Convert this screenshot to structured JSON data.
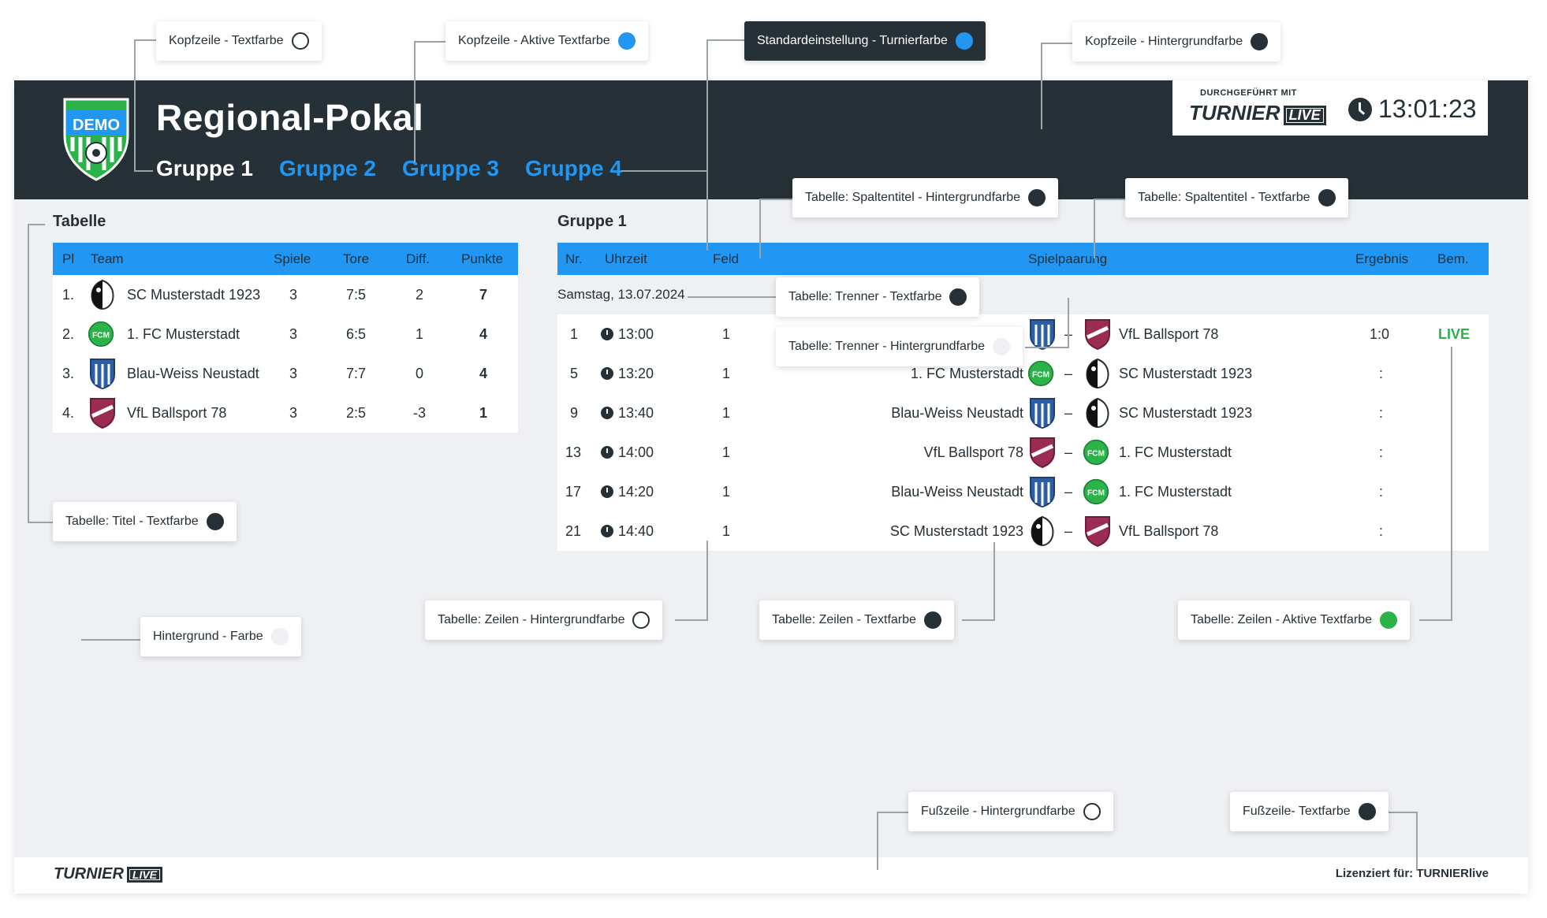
{
  "header": {
    "title": "Regional-Pokal",
    "logo_text": "DEMO",
    "tabs": [
      {
        "label": "Gruppe 1",
        "active": true
      },
      {
        "label": "Gruppe 2",
        "active": false
      },
      {
        "label": "Gruppe 3",
        "active": false
      },
      {
        "label": "Gruppe 4",
        "active": false
      }
    ],
    "brand_subtitle": "DURCHGEFÜHRT MIT",
    "brand_name": "TURNIER",
    "brand_live": "LIVE",
    "clock": "13:01:23"
  },
  "standings": {
    "title": "Tabelle",
    "columns": [
      "Pl",
      "Team",
      "Spiele",
      "Tore",
      "Diff.",
      "Punkte"
    ],
    "rows": [
      {
        "pl": "1.",
        "team": "SC Musterstadt 1923",
        "crest": "sc",
        "spiele": "3",
        "tore": "7:5",
        "diff": "2",
        "punkte": "7"
      },
      {
        "pl": "2.",
        "team": "1. FC Musterstadt",
        "crest": "fcm",
        "spiele": "3",
        "tore": "6:5",
        "diff": "1",
        "punkte": "4"
      },
      {
        "pl": "3.",
        "team": "Blau-Weiss Neustadt",
        "crest": "bw",
        "spiele": "3",
        "tore": "7:7",
        "diff": "0",
        "punkte": "4"
      },
      {
        "pl": "4.",
        "team": "VfL Ballsport 78",
        "crest": "vfl",
        "spiele": "3",
        "tore": "2:5",
        "diff": "-3",
        "punkte": "1"
      }
    ]
  },
  "matches": {
    "title": "Gruppe 1",
    "columns": [
      "Nr.",
      "Uhrzeit",
      "Feld",
      "Spielpaarung",
      "Ergebnis",
      "Bem."
    ],
    "date_divider": "Samstag, 13.07.2024",
    "rows": [
      {
        "nr": "1",
        "time": "13:00",
        "field": "1",
        "home": "",
        "home_crest": "bw",
        "away": "VfL Ballsport 78",
        "away_crest": "vfl",
        "result": "1:0",
        "note": "LIVE"
      },
      {
        "nr": "5",
        "time": "13:20",
        "field": "1",
        "home": "1. FC Musterstadt",
        "home_crest": "fcm",
        "away": "SC Musterstadt 1923",
        "away_crest": "sc",
        "result": ":",
        "note": ""
      },
      {
        "nr": "9",
        "time": "13:40",
        "field": "1",
        "home": "Blau-Weiss Neustadt",
        "home_crest": "bw",
        "away": "SC Musterstadt 1923",
        "away_crest": "sc",
        "result": ":",
        "note": ""
      },
      {
        "nr": "13",
        "time": "14:00",
        "field": "1",
        "home": "VfL Ballsport 78",
        "home_crest": "vfl",
        "away": "1. FC Musterstadt",
        "away_crest": "fcm",
        "result": ":",
        "note": ""
      },
      {
        "nr": "17",
        "time": "14:20",
        "field": "1",
        "home": "Blau-Weiss Neustadt",
        "home_crest": "bw",
        "away": "1. FC Musterstadt",
        "away_crest": "fcm",
        "result": ":",
        "note": ""
      },
      {
        "nr": "21",
        "time": "14:40",
        "field": "1",
        "home": "SC Musterstadt 1923",
        "home_crest": "sc",
        "away": "VfL Ballsport 78",
        "away_crest": "vfl",
        "result": ":",
        "note": ""
      }
    ],
    "separator": "–"
  },
  "footer": {
    "brand_name": "TURNIER",
    "brand_live": "LIVE",
    "license": "Lizenziert für: TURNIERlive"
  },
  "callouts": [
    {
      "label": "Kopfzeile - Textfarbe",
      "color": "#ffffff",
      "dark": false
    },
    {
      "label": "Kopfzeile - Aktive Textfarbe",
      "color": "#2196f3",
      "dark": false
    },
    {
      "label": "Standardeinstellung - Turnierfarbe",
      "color": "#2196f3",
      "dark": true
    },
    {
      "label": "Kopfzeile - Hintergrundfarbe",
      "color": "#253037",
      "dark": false
    },
    {
      "label": "Tabelle: Spaltentitel - Hintergrundfarbe",
      "color": "#253037",
      "dark": false
    },
    {
      "label": "Tabelle: Spaltentitel - Textfarbe",
      "color": "#253037",
      "dark": false
    },
    {
      "label": "Tabelle: Trenner - Textfarbe",
      "color": "#253037",
      "dark": false
    },
    {
      "label": "Tabelle: Trenner - Hintergrundfarbe",
      "color": "#eef0f3",
      "dark": false
    },
    {
      "label": "Tabelle: Titel - Textfarbe",
      "color": "#253037",
      "dark": false
    },
    {
      "label": "Hintergrund - Farbe",
      "color": "#eef0f3",
      "dark": false
    },
    {
      "label": "Tabelle: Zeilen - Hintergrundfarbe",
      "color": "#ffffff",
      "dark": false
    },
    {
      "label": "Tabelle: Zeilen - Textfarbe",
      "color": "#253037",
      "dark": false
    },
    {
      "label": "Tabelle: Zeilen - Aktive Textfarbe",
      "color": "#2bb34a",
      "dark": false
    },
    {
      "label": "Fußzeile - Hintergrundfarbe",
      "color": "#ffffff",
      "dark": false
    },
    {
      "label": "Fußzeile- Textfarbe",
      "color": "#253037",
      "dark": false
    }
  ]
}
